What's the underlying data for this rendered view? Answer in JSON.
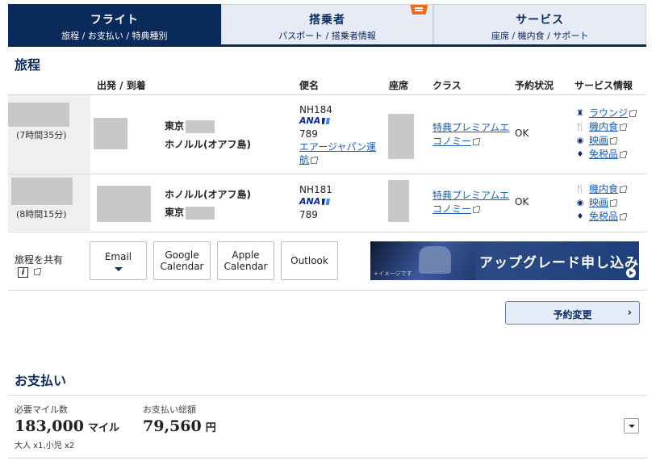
{
  "tabs": [
    {
      "title": "フライト",
      "sub": "旅程 / お支払い / 特典種別"
    },
    {
      "title": "搭乗者",
      "sub": "パスポート / 搭乗者情報"
    },
    {
      "title": "サービス",
      "sub": "座席 / 機内食 / サポート"
    }
  ],
  "itinerary": {
    "heading": "旅程",
    "headers": {
      "route": "出発 / 到着",
      "flight": "便名",
      "seat": "座席",
      "class": "クラス",
      "status": "予約状況",
      "services": "サービス情報"
    },
    "flights": [
      {
        "duration": "(7時間35分)",
        "from": "東京",
        "to": "ホノルル(オアフ島)",
        "flight_no": "NH184",
        "airline": "ANA",
        "equipment": "789",
        "operator": "エアージャパン運航",
        "cabin": "特典プレミアムエコノミー",
        "status": "OK",
        "services": [
          {
            "icon": "lounge-icon",
            "label": "ラウンジ"
          },
          {
            "icon": "meal-icon",
            "label": "機内食"
          },
          {
            "icon": "movie-icon",
            "label": "映画"
          },
          {
            "icon": "dutyfree-icon",
            "label": "免税品"
          }
        ]
      },
      {
        "duration": "(8時間15分)",
        "from": "ホノルル(オアフ島)",
        "to": "東京",
        "flight_no": "NH181",
        "airline": "ANA",
        "equipment": "789",
        "cabin": "特典プレミアムエコノミー",
        "status": "OK",
        "services": [
          {
            "icon": "meal-icon",
            "label": "機内食"
          },
          {
            "icon": "movie-icon",
            "label": "映画"
          },
          {
            "icon": "dutyfree-icon",
            "label": "免税品"
          }
        ]
      }
    ]
  },
  "share": {
    "label": "旅程を共有",
    "buttons": {
      "email": "Email",
      "google_1": "Google",
      "google_2": "Calendar",
      "apple_1": "Apple",
      "apple_2": "Calendar",
      "outlook": "Outlook"
    }
  },
  "banner": {
    "text": "アップグレード申し込み",
    "note": "+イメージです"
  },
  "change_button": "予約変更",
  "payment": {
    "heading": "お支払い",
    "miles_label": "必要マイル数",
    "miles_value": "183,000",
    "miles_unit": "マイル",
    "total_label": "お支払い総額",
    "total_value": "79,560",
    "total_unit": "円",
    "passengers": "大人 x1,小児 x2"
  },
  "colors": {
    "brand_navy": "#0b2a5c",
    "link": "#1a5fb4",
    "tab_inactive": "#e7ebf5",
    "badge_orange": "#f26b1d"
  }
}
